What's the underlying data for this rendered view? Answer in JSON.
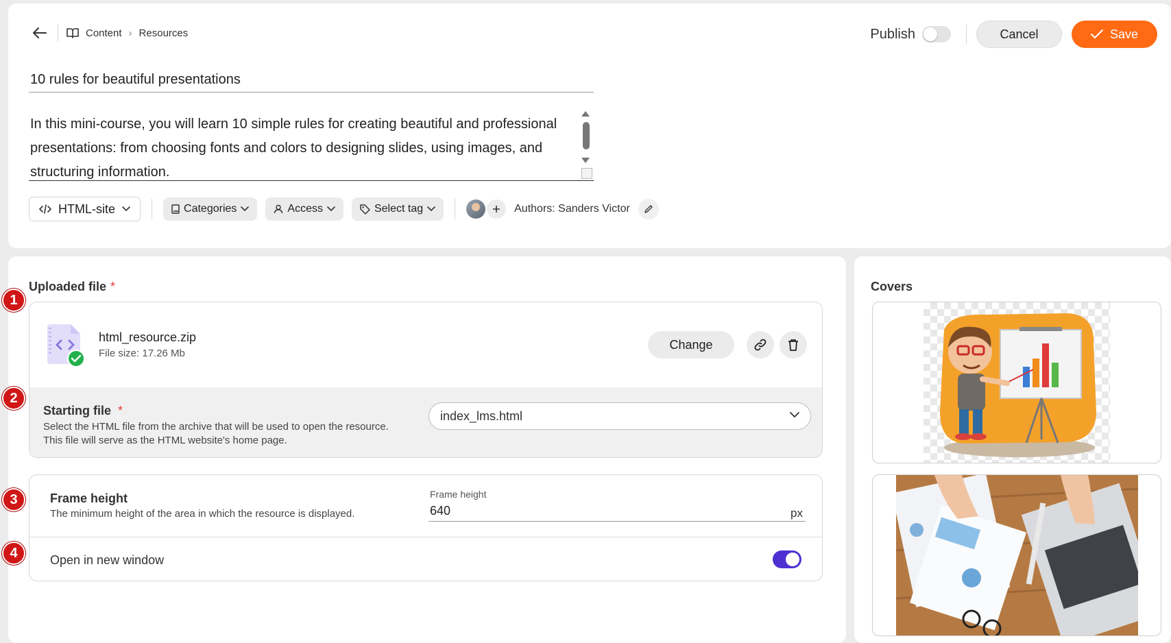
{
  "breadcrumb": {
    "items": [
      "Content",
      "Resources"
    ]
  },
  "header": {
    "publish_label": "Publish",
    "publish_on": false,
    "cancel_label": "Cancel",
    "save_label": "Save"
  },
  "resource": {
    "title": "10 rules for beautiful presentations",
    "description": "In this mini-course, you will learn 10 simple rules for creating beautiful and professional presentations: from choosing fonts and colors to designing slides, using images, and structuring information."
  },
  "toolbar": {
    "type_label": "HTML-site",
    "categories_label": "Categories",
    "access_label": "Access",
    "tag_label": "Select tag",
    "authors_text": "Authors: Sanders Victor"
  },
  "uploaded_file": {
    "section_title": "Uploaded file",
    "required_mark": "*",
    "file_name": "html_resource.zip",
    "file_size": "File size: 17.26 Mb",
    "change_label": "Change"
  },
  "starting_file": {
    "title": "Starting file",
    "required_mark": "*",
    "description": "Select the HTML file from the archive that will be used to open the resource. This file will serve as the HTML website's home page.",
    "selected_value": "index_lms.html"
  },
  "frame_height": {
    "title": "Frame height",
    "description": "The minimum height of the area in which the resource is displayed.",
    "field_label": "Frame height",
    "value": "640",
    "unit": "px"
  },
  "open_new_window": {
    "label": "Open in new window",
    "enabled": true
  },
  "covers": {
    "title": "Covers"
  },
  "annotations": [
    "1",
    "2",
    "3",
    "4"
  ],
  "colors": {
    "accent": "#ff6a13",
    "toggle_on": "#4e2fd1",
    "badge": "#d01616",
    "success": "#22b14c"
  }
}
